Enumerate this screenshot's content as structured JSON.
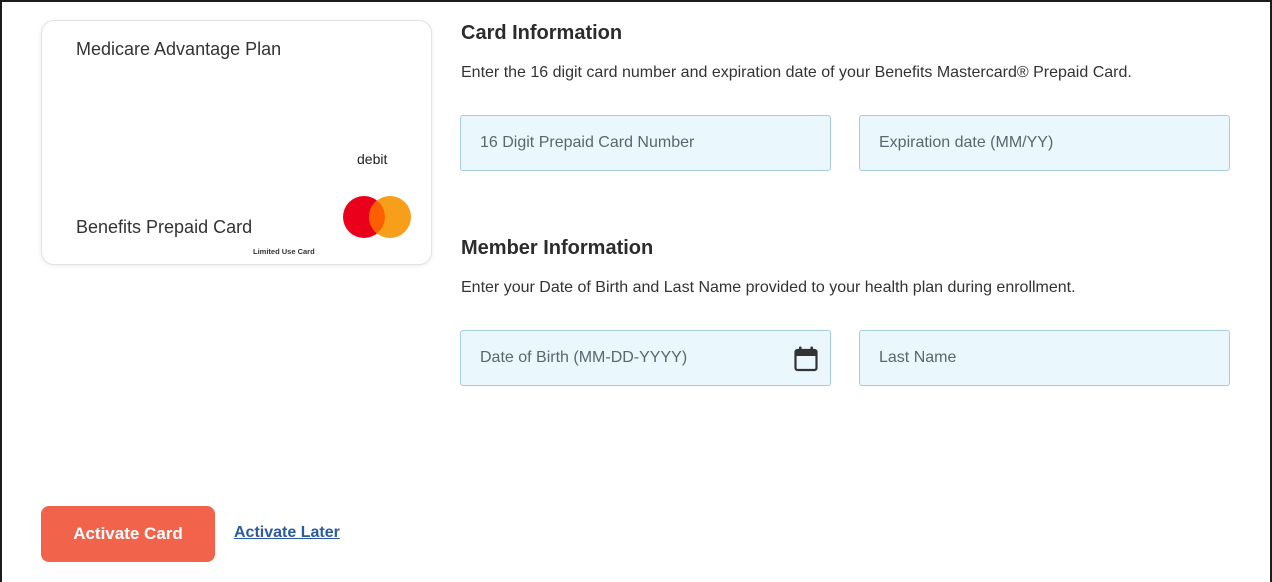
{
  "card_preview": {
    "plan_name": "Medicare Advantage Plan",
    "card_type": "debit",
    "card_name": "Benefits Prepaid Card",
    "limited_use": "Limited Use Card",
    "logo": "mastercard-logo",
    "logo_colors": [
      "#eb001b",
      "#f79e1b",
      "#ff5f00"
    ]
  },
  "card_info": {
    "title": "Card Information",
    "description": "Enter the 16 digit card number and expiration date of your Benefits Mastercard® Prepaid Card.",
    "card_number_placeholder": "16 Digit Prepaid Card Number",
    "card_number_value": "",
    "expiration_placeholder": "Expiration date (MM/YY)",
    "expiration_value": ""
  },
  "member_info": {
    "title": "Member Information",
    "description": "Enter your Date of Birth and Last Name provided to your health plan during enrollment.",
    "dob_placeholder": "Date of Birth (MM-DD-YYYY)",
    "dob_value": "",
    "dob_icon": "calendar-icon",
    "last_name_placeholder": "Last Name",
    "last_name_value": ""
  },
  "actions": {
    "activate_label": "Activate Card",
    "later_label": "Activate Later"
  },
  "colors": {
    "primary_button": "#f2634c",
    "input_background": "#eaf7fd",
    "input_border": "#a9cbe0",
    "link": "#2c5aa0"
  }
}
